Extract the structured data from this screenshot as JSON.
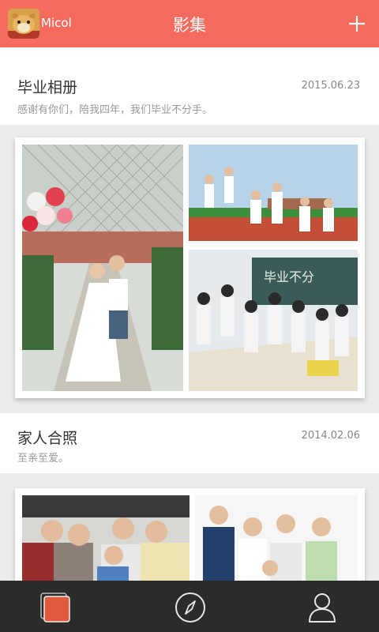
{
  "header": {
    "user_name": "Micol",
    "title": "影集",
    "add_icon": "plus-icon",
    "background": "#f56c5f"
  },
  "albums": [
    {
      "title": "毕业相册",
      "date": "2015.06.23",
      "description": "感谢有你们，陪我四年，我们毕业不分手。",
      "photo_count_visible": 3
    },
    {
      "title": "家人合照",
      "date": "2014.02.06",
      "description": "至亲至爱。",
      "photo_count_visible": 2
    }
  ],
  "tabbar": {
    "background": "#2b2b2b",
    "tabs": [
      {
        "icon": "albums-icon",
        "active": true,
        "color": "#e05a40"
      },
      {
        "icon": "compass-icon",
        "active": false
      },
      {
        "icon": "profile-icon",
        "active": false
      }
    ]
  }
}
